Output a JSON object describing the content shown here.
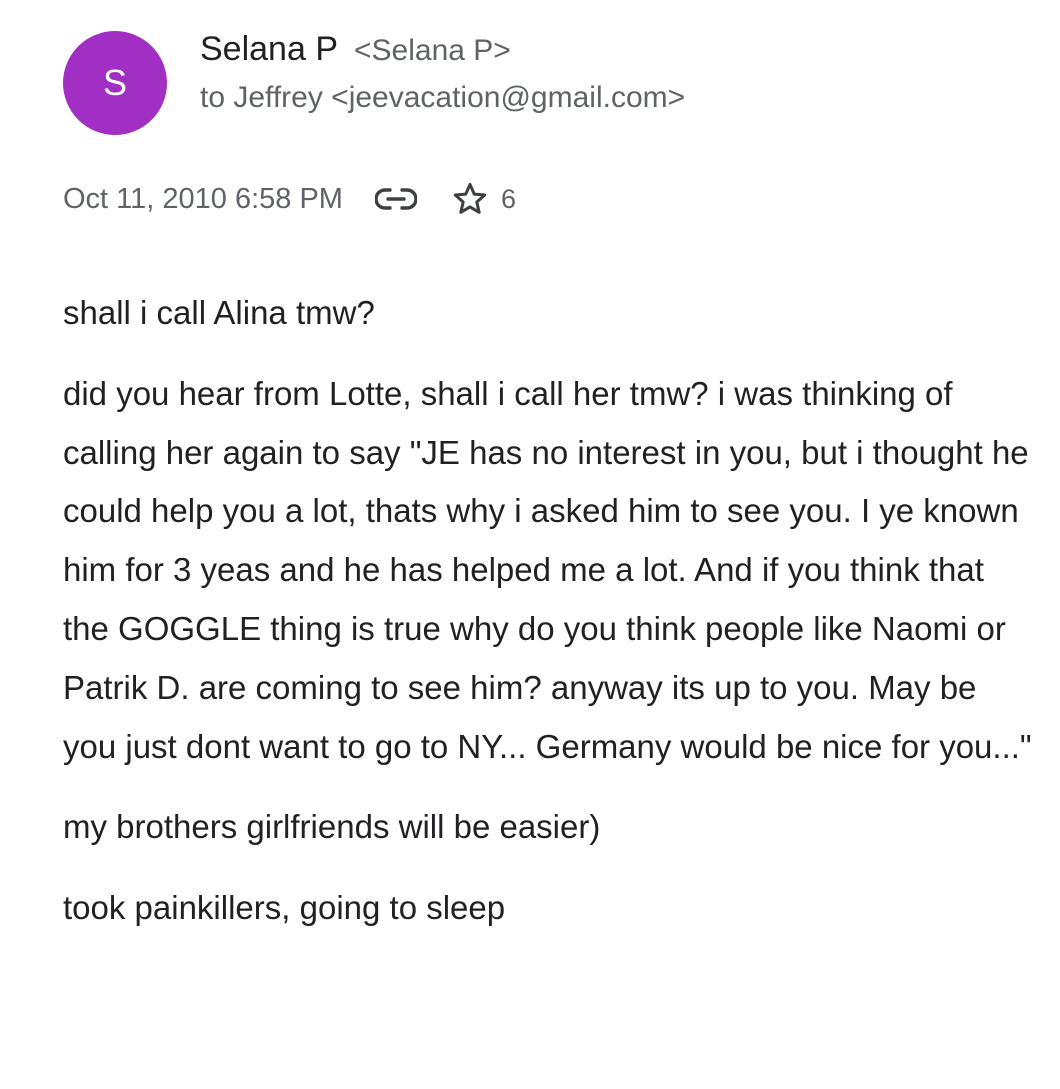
{
  "sender": {
    "avatar_initial": "S",
    "avatar_color": "#a22fc3",
    "name": "Selana P",
    "email": "<Selana P>"
  },
  "recipient": {
    "line": "to Jeffrey <jeevacation@gmail.com>"
  },
  "meta": {
    "date": "Oct 11, 2010 6:58 PM",
    "link_icon": "link-icon",
    "star_icon": "star-outline-icon",
    "star_count": "6"
  },
  "message": {
    "paragraphs": [
      "shall i call Alina tmw?",
      "did you hear from Lotte, shall i call her tmw? i was thinking of calling her again to say \"JE has no interest in you, but i thought he could help you a lot, thats why i asked him to see you. I ye known him for 3 yeas and he has helped me a lot. And if you think that the GOGGLE thing is true why do you think people like Naomi or Patrik D. are coming to see him? anyway its up to you. May be you just dont want to go to NY... Germany would be nice for you...\"",
      "my brothers girlfriends will be easier)",
      "took painkillers, going to sleep"
    ]
  }
}
